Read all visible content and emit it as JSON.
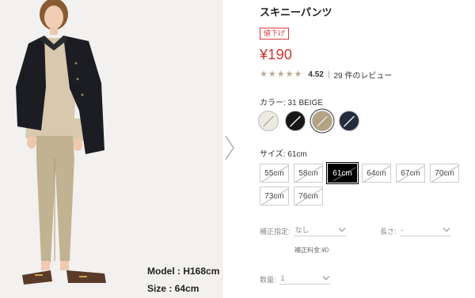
{
  "model_info": {
    "height": "Model : H168cm",
    "size": "Size : 64cm"
  },
  "product": {
    "title": "スキニーパンツ",
    "badge": "値下げ",
    "price": "¥190",
    "rating": {
      "stars": 5,
      "score": "4.52",
      "separator": "|",
      "count": "29 件のレビュー"
    }
  },
  "color": {
    "label": "カラー: 31 BEIGE",
    "options": [
      {
        "name": "off-white",
        "hex": "#eceae3"
      },
      {
        "name": "black",
        "hex": "#161616"
      },
      {
        "name": "beige",
        "hex": "#b5a283",
        "selected": true
      },
      {
        "name": "navy",
        "hex": "#242c3c"
      }
    ]
  },
  "size": {
    "label": "サイズ: 61cm",
    "options": [
      {
        "label": "55cm"
      },
      {
        "label": "58cm"
      },
      {
        "label": "61cm",
        "selected": true
      },
      {
        "label": "64cm"
      },
      {
        "label": "67cm"
      },
      {
        "label": "70cm"
      },
      {
        "label": "73cm"
      },
      {
        "label": "76cm"
      }
    ]
  },
  "alteration": {
    "label": "補正指定:",
    "value": "なし"
  },
  "length": {
    "label": "長さ:",
    "value": "-"
  },
  "fee": "補正料金:¥0",
  "quantity": {
    "label": "数量:",
    "value": "1"
  },
  "colors": {
    "price_red": "#d0312d",
    "badge_red": "#d73a3a",
    "star": "#b7ab8f",
    "selected_size_bg": "#000000"
  }
}
